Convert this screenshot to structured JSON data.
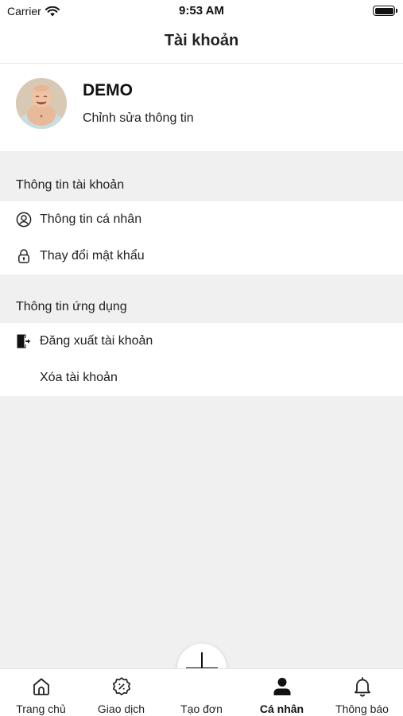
{
  "status_bar": {
    "carrier": "Carrier",
    "time": "9:53 AM"
  },
  "header": {
    "title": "Tài khoản"
  },
  "profile": {
    "name": "DEMO",
    "edit_label": "Chỉnh sửa thông tin"
  },
  "sections": [
    {
      "title": "Thông tin tài khoản",
      "items": [
        {
          "label": "Thông tin cá nhân",
          "icon": "user-circle-icon"
        },
        {
          "label": "Thay đổi mật khẩu",
          "icon": "lock-icon"
        }
      ]
    },
    {
      "title": "Thông tin ứng dụng",
      "items": [
        {
          "label": "Đăng xuất tài khoản",
          "icon": "logout-icon"
        },
        {
          "label": "Xóa tài khoản",
          "icon": ""
        }
      ]
    }
  ],
  "tab_bar": {
    "tabs": [
      {
        "label": "Trang chủ",
        "icon": "home-icon"
      },
      {
        "label": "Giao dịch",
        "icon": "discount-badge-icon"
      },
      {
        "label": "Tạo đơn",
        "icon": "plus-icon"
      },
      {
        "label": "Cá nhân",
        "icon": "person-icon",
        "active": true
      },
      {
        "label": "Thông báo",
        "icon": "bell-icon"
      }
    ]
  }
}
